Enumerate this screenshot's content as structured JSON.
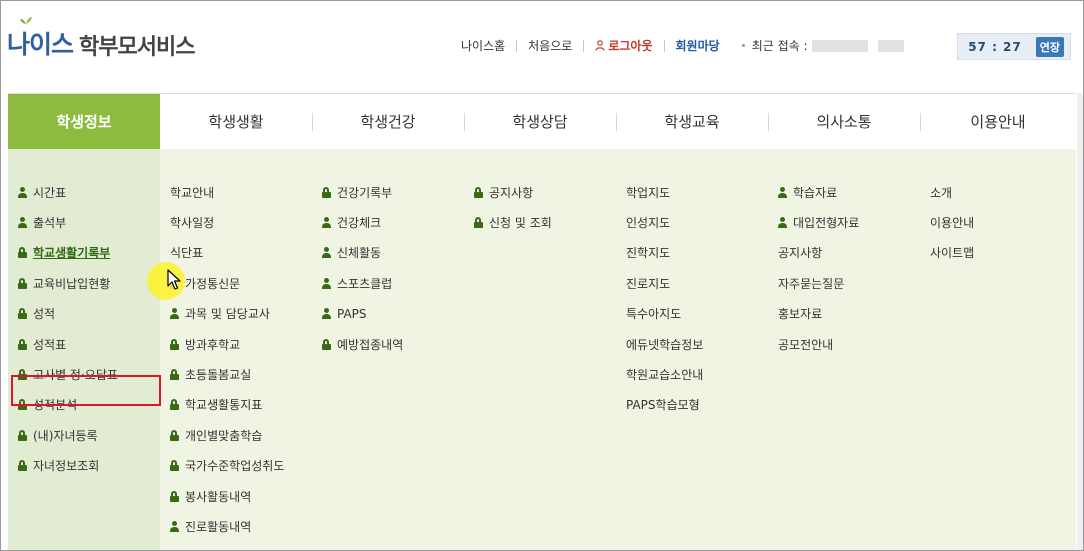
{
  "header": {
    "logo_neis": "나이스",
    "logo_service": "학부모서비스",
    "links": {
      "neis_home": "나이스홈",
      "first": "처음으로",
      "logout": "로그아웃",
      "member": "회원마당",
      "recent_label": "최근 접속 :"
    },
    "timer": "57 : 27",
    "extend_label": "연장"
  },
  "main_nav": [
    {
      "label": "학생정보",
      "active": true
    },
    {
      "label": "학생생활",
      "active": false
    },
    {
      "label": "학생건강",
      "active": false
    },
    {
      "label": "학생상담",
      "active": false
    },
    {
      "label": "학생교육",
      "active": false
    },
    {
      "label": "의사소통",
      "active": false
    },
    {
      "label": "이용안내",
      "active": false
    }
  ],
  "menu_columns": [
    [
      {
        "label": "시간표",
        "icon": "user-icon"
      },
      {
        "label": "출석부",
        "icon": "user-icon"
      },
      {
        "label": "학교생활기록부",
        "icon": "lock-icon",
        "highlight": true
      },
      {
        "label": "교육비납입현황",
        "icon": "lock-icon"
      },
      {
        "label": "성적",
        "icon": "lock-icon"
      },
      {
        "label": "성적표",
        "icon": "lock-icon"
      },
      {
        "label": "고사별 정·오답표",
        "icon": "lock-icon"
      },
      {
        "label": "성적분석",
        "icon": "lock-icon"
      },
      {
        "label": "(내)자녀등록",
        "icon": "lock-icon"
      },
      {
        "label": "자녀정보조회",
        "icon": "lock-icon"
      }
    ],
    [
      {
        "label": "학교안내",
        "icon": ""
      },
      {
        "label": "학사일정",
        "icon": ""
      },
      {
        "label": "식단표",
        "icon": ""
      },
      {
        "label": "가정통신문",
        "icon": "user-icon"
      },
      {
        "label": "과목 및 담당교사",
        "icon": "user-icon"
      },
      {
        "label": "방과후학교",
        "icon": "lock-icon"
      },
      {
        "label": "초등돌봄교실",
        "icon": "lock-icon"
      },
      {
        "label": "학교생활통지표",
        "icon": "lock-icon"
      },
      {
        "label": "개인별맞춤학습",
        "icon": "lock-icon"
      },
      {
        "label": "국가수준학업성취도",
        "icon": "lock-icon"
      },
      {
        "label": "봉사활동내역",
        "icon": "lock-icon"
      },
      {
        "label": "진로활동내역",
        "icon": "user-icon"
      }
    ],
    [
      {
        "label": "건강기록부",
        "icon": "lock-icon"
      },
      {
        "label": "건강체크",
        "icon": "user-icon"
      },
      {
        "label": "신체활동",
        "icon": "user-icon"
      },
      {
        "label": "스포츠클럽",
        "icon": "user-icon"
      },
      {
        "label": "PAPS",
        "icon": "user-icon"
      },
      {
        "label": "예방접종내역",
        "icon": "lock-icon"
      }
    ],
    [
      {
        "label": "공지사항",
        "icon": "lock-icon"
      },
      {
        "label": "신청 및 조회",
        "icon": "lock-icon"
      }
    ],
    [
      {
        "label": "학업지도",
        "icon": ""
      },
      {
        "label": "인성지도",
        "icon": ""
      },
      {
        "label": "진학지도",
        "icon": ""
      },
      {
        "label": "진로지도",
        "icon": ""
      },
      {
        "label": "특수아지도",
        "icon": ""
      },
      {
        "label": "에듀넷학습정보",
        "icon": ""
      },
      {
        "label": "학원교습소안내",
        "icon": ""
      },
      {
        "label": "PAPS학습모형",
        "icon": ""
      }
    ],
    [
      {
        "label": "학습자료",
        "icon": "user-icon"
      },
      {
        "label": "대입전형자료",
        "icon": "user-icon"
      },
      {
        "label": "공지사항",
        "icon": ""
      },
      {
        "label": "자주묻는질문",
        "icon": ""
      },
      {
        "label": "홍보자료",
        "icon": ""
      },
      {
        "label": "공모전안내",
        "icon": ""
      }
    ],
    [
      {
        "label": "소개",
        "icon": ""
      },
      {
        "label": "이용안내",
        "icon": ""
      },
      {
        "label": "사이트맵",
        "icon": ""
      }
    ]
  ],
  "colors": {
    "active_tab": "#8dbb40",
    "panel_bg": "#eff5e2",
    "icon": "#3b6a16",
    "highlight_box": "#d9182b"
  }
}
